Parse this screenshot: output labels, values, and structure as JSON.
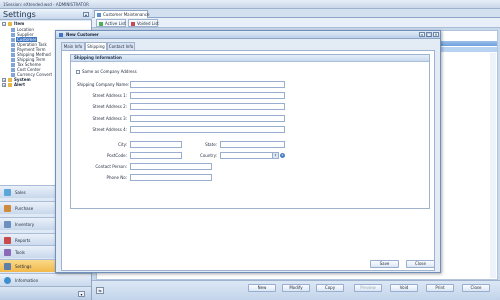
{
  "window": {
    "title": "1Session: eXtended.wsd - ADMINISTRATOR"
  },
  "sidebar": {
    "heading": "Settings",
    "tree": [
      {
        "label": "Item",
        "bold": true
      },
      {
        "label": "Location"
      },
      {
        "label": "Supplier"
      },
      {
        "label": "Customer",
        "selected": true
      },
      {
        "label": "Operation Task"
      },
      {
        "label": "Payment Term"
      },
      {
        "label": "Shipping Method"
      },
      {
        "label": "Shipping Term"
      },
      {
        "label": "Tax Scheme"
      },
      {
        "label": "Cost Center"
      },
      {
        "label": "Currency Convert"
      },
      {
        "label": "System",
        "bold": true
      },
      {
        "label": "Alert",
        "bold": true
      }
    ],
    "nav": [
      {
        "label": "Sales",
        "color": "#5aa6d8"
      },
      {
        "label": "Purchase",
        "color": "#d08a3c"
      },
      {
        "label": "Inventory",
        "color": "#6c8fbf"
      },
      {
        "label": "Reports",
        "color": "#c94a4a"
      },
      {
        "label": "Tools",
        "color": "#8b6ab8"
      },
      {
        "label": "Settings",
        "color": "#5f7fa8",
        "active": true
      },
      {
        "label": "Information",
        "color": "#3e8fd0"
      }
    ]
  },
  "doc_tab": {
    "label": "Customer Maintenance"
  },
  "sub_tabs": {
    "active_list": "Active List",
    "voided_list": "Voided List"
  },
  "dialog": {
    "title": "New Customer",
    "tabs": [
      "Main Info",
      "Shipping",
      "Contact Info"
    ],
    "group_title": "Shipping Information",
    "same_as": "Same as Company Address",
    "fields": {
      "company_name": "Shipping Company Name:",
      "address1": "Street Address 1:",
      "address2": "Street Address 2:",
      "address3": "Street Address 3:",
      "address4": "Street Address 4:",
      "city": "City:",
      "state": "State:",
      "postcode": "PostCode:",
      "country": "Country:",
      "contact": "Contact Person:",
      "phone": "Phone No:"
    },
    "save": "Save",
    "close": "Close"
  },
  "toolbar": {
    "new": "New",
    "modify": "Modify",
    "copy": "Copy",
    "preview": "Preview",
    "void": "Void",
    "print": "Print",
    "close": "Close"
  }
}
